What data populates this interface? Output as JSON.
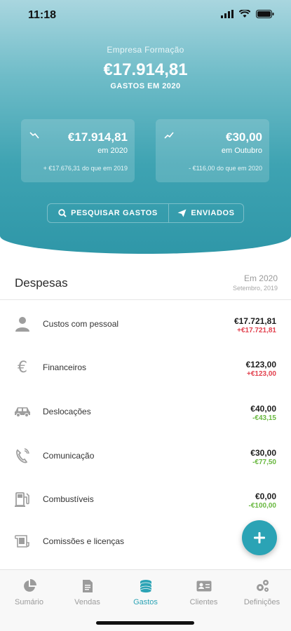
{
  "status_bar": {
    "time": "11:18"
  },
  "header": {
    "company": "Empresa Formação",
    "total": "€17.914,81",
    "total_label": "GASTOS EM 2020"
  },
  "cards": [
    {
      "amount": "€17.914,81",
      "period": "em 2020",
      "compare": "+ €17.676,31 do que em 2019",
      "trend": "down-trend-icon"
    },
    {
      "amount": "€30,00",
      "period": "em Outubro",
      "compare": "- €116,00 do que em 2020",
      "trend": "up-trend-icon"
    }
  ],
  "actions": {
    "search_label": "PESQUISAR GASTOS",
    "sent_label": "ENVIADOS"
  },
  "expenses": {
    "title": "Despesas",
    "period_main": "Em 2020",
    "period_sub": "Setembro, 2019",
    "rows": [
      {
        "name": "Custos com pessoal",
        "value": "€17.721,81",
        "delta": "+€17.721,81",
        "direction": "up",
        "icon": "person-icon"
      },
      {
        "name": "Financeiros",
        "value": "€123,00",
        "delta": "+€123,00",
        "direction": "up",
        "icon": "euro-icon"
      },
      {
        "name": "Deslocações",
        "value": "€40,00",
        "delta": "-€43,15",
        "direction": "down",
        "icon": "car-icon"
      },
      {
        "name": "Comunicação",
        "value": "€30,00",
        "delta": "-€77,50",
        "direction": "down",
        "icon": "phone-icon"
      },
      {
        "name": "Combustíveis",
        "value": "€0,00",
        "delta": "-€100,00",
        "direction": "down",
        "icon": "fuel-pump-icon"
      },
      {
        "name": "Comissões e licenças",
        "value": "",
        "delta": "",
        "direction": "",
        "icon": "license-icon"
      }
    ]
  },
  "fab": {
    "icon": "plus-icon"
  },
  "tabbar": {
    "active": "Gastos",
    "tabs": [
      {
        "label": "Sumário",
        "icon": "pie-chart-icon"
      },
      {
        "label": "Vendas",
        "icon": "invoice-icon"
      },
      {
        "label": "Gastos",
        "icon": "coins-icon"
      },
      {
        "label": "Clientes",
        "icon": "contact-card-icon"
      },
      {
        "label": "Definições",
        "icon": "gears-icon"
      }
    ]
  },
  "colors": {
    "accent": "#2ba3b5",
    "negative": "#e2414e",
    "positive": "#69b840"
  }
}
